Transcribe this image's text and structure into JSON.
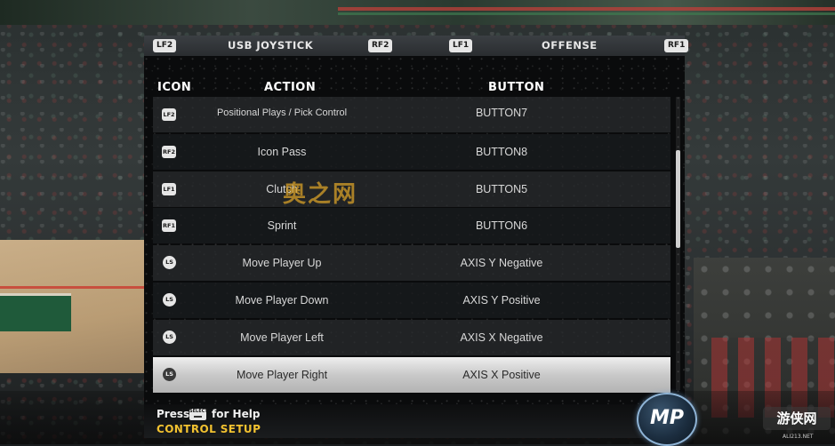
{
  "top_nav": {
    "left_badge": "LF2",
    "left_label": "USB JOYSTICK",
    "left_right_badge": "RF2",
    "right_left_badge": "LF1",
    "right_label": "OFFENSE",
    "right_badge": "RF1"
  },
  "columns": {
    "icon": "ICON",
    "action": "ACTION",
    "button": "BUTTON"
  },
  "rows": [
    {
      "icon": "LF2",
      "icon_shape": "badge",
      "action": "Positional Plays / Pick Control",
      "button": "BUTTON7"
    },
    {
      "icon": "RF2",
      "icon_shape": "badge",
      "action": "Icon Pass",
      "button": "BUTTON8"
    },
    {
      "icon": "LF1",
      "icon_shape": "badge",
      "action": "Clutch",
      "button": "BUTTON5"
    },
    {
      "icon": "RF1",
      "icon_shape": "badge",
      "action": "Sprint",
      "button": "BUTTON6"
    },
    {
      "icon": "LS",
      "icon_shape": "round",
      "action": "Move Player Up",
      "button": "AXIS Y Negative"
    },
    {
      "icon": "LS",
      "icon_shape": "round",
      "action": "Move Player Down",
      "button": "AXIS Y Positive"
    },
    {
      "icon": "LS",
      "icon_shape": "round",
      "action": "Move Player Left",
      "button": "AXIS X Negative"
    },
    {
      "icon": "LS",
      "icon_shape": "round",
      "action": "Move Player Right",
      "button": "AXIS X Positive",
      "selected": true
    }
  ],
  "help": {
    "press": "Press",
    "select_key": "SELECT",
    "for_help": "for Help",
    "screen_title": "CONTROL SETUP"
  },
  "logo": {
    "text": "MP"
  },
  "watermarks": {
    "center": "奥之网",
    "corner": "游侠网",
    "corner_url": "ALI213.NET"
  },
  "colors": {
    "accent_yellow": "#f2c230",
    "selected_row": "#d9d9d9",
    "panel_bg": "#0a0b0c"
  }
}
